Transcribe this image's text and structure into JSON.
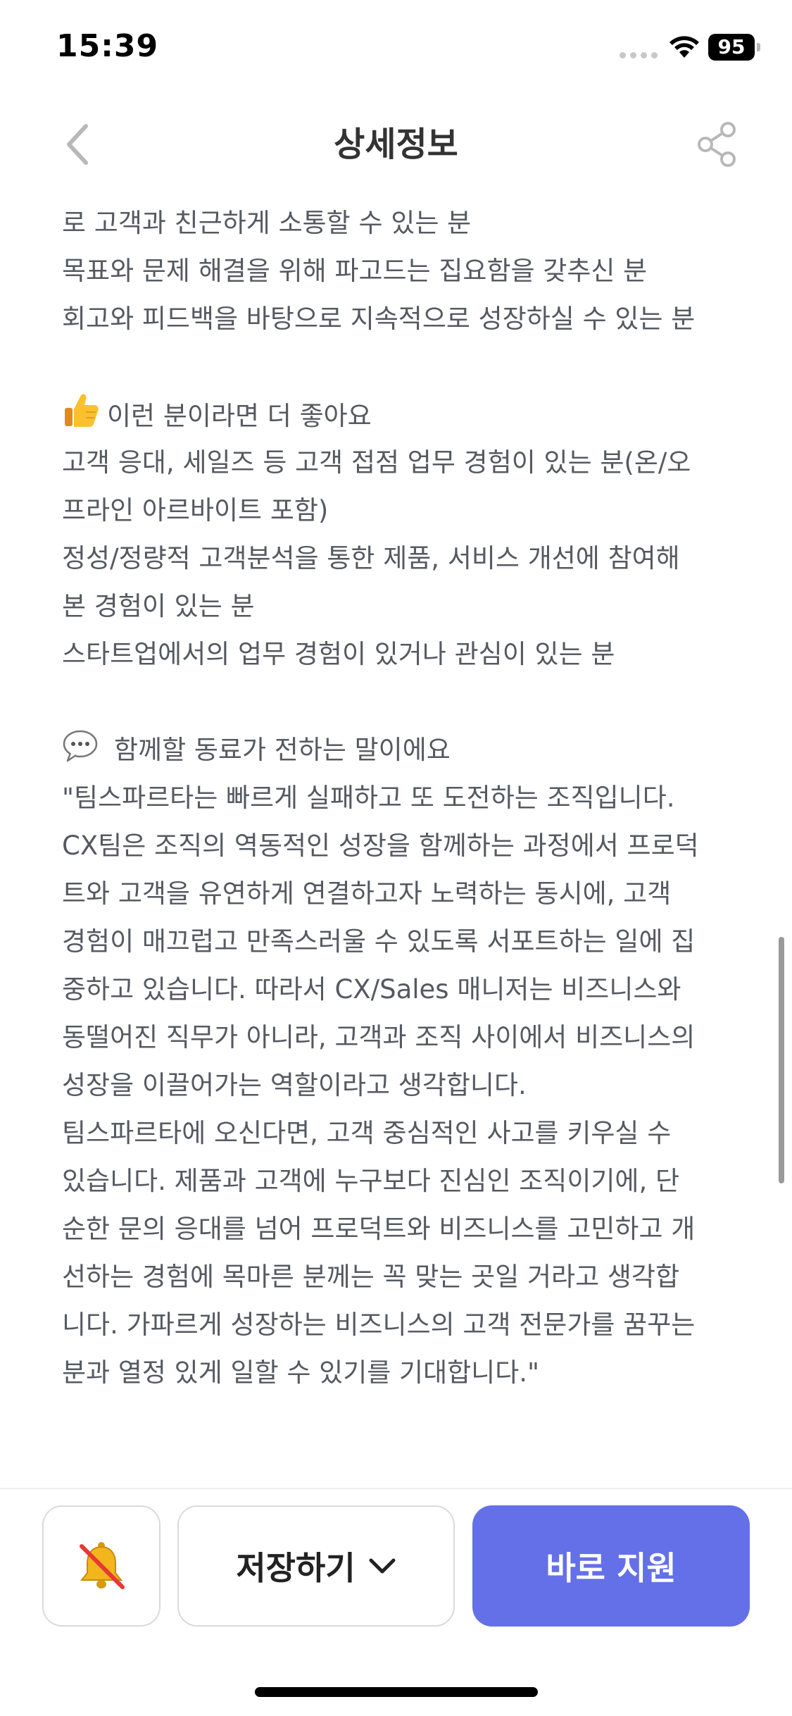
{
  "status_bar": {
    "time": "15:39",
    "battery": "95",
    "icons": [
      "signal-dots-icon",
      "wifi-icon",
      "battery-icon"
    ]
  },
  "nav": {
    "title": "상세정보",
    "back_icon": "chevron-left-icon",
    "share_icon": "share-icon"
  },
  "content": {
    "intro_lines": [
      "로 고객과 친근하게 소통할 수 있는 분",
      "목표와 문제 해결을 위해 파고드는 집요함을 갖추신 분",
      "회고와 피드백을 바탕으로 지속적으로 성장하실 수 있는 분"
    ],
    "preferred": {
      "emoji": "👍",
      "heading": "이런 분이라면 더 좋아요",
      "lines": [
        "고객 응대, 세일즈 등 고객 접점 업무 경험이 있는 분(온/오",
        "프라인 아르바이트 포함)",
        "정성/정량적 고객분석을 통한 제품, 서비스 개선에 참여해",
        "본 경험이 있는 분",
        "스타트업에서의 업무 경험이 있거나 관심이 있는 분"
      ]
    },
    "colleague": {
      "emoji": "💬",
      "heading": "함께할 동료가 전하는 말이에요",
      "lines": [
        "\"팀스파르타는 빠르게 실패하고 또 도전하는 조직입니다.",
        "CX팀은 조직의 역동적인 성장을 함께하는 과정에서 프로덕",
        "트와 고객을 유연하게 연결하고자 노력하는 동시에, 고객",
        "경험이 매끄럽고 만족스러울 수 있도록 서포트하는 일에 집",
        "중하고 있습니다. 따라서 CX/Sales 매니저는 비즈니스와",
        "동떨어진 직무가 아니라, 고객과 조직 사이에서 비즈니스의",
        "성장을 이끌어가는 역할이라고 생각합니다.",
        "팀스파르타에 오신다면, 고객 중심적인 사고를 키우실 수",
        "있습니다. 제품과 고객에 누구보다 진심인 조직이기에, 단",
        "순한 문의 응대를 넘어 프로덕트와 비즈니스를 고민하고 개",
        "선하는 경험에 목마른 분께는 꼭 맞는 곳일 거라고 생각합",
        "니다. 가파르게 성장하는 비즈니스의 고객 전문가를 꿈꾸는",
        "분과 열정 있게 일할 수 있기를 기대합니다.\""
      ]
    }
  },
  "bottom_bar": {
    "alarm_icon": "bell-off-icon",
    "save_label": "저장하기",
    "save_icon": "chevron-down-icon",
    "apply_label": "바로 지원",
    "apply_color": "#6470e8"
  }
}
